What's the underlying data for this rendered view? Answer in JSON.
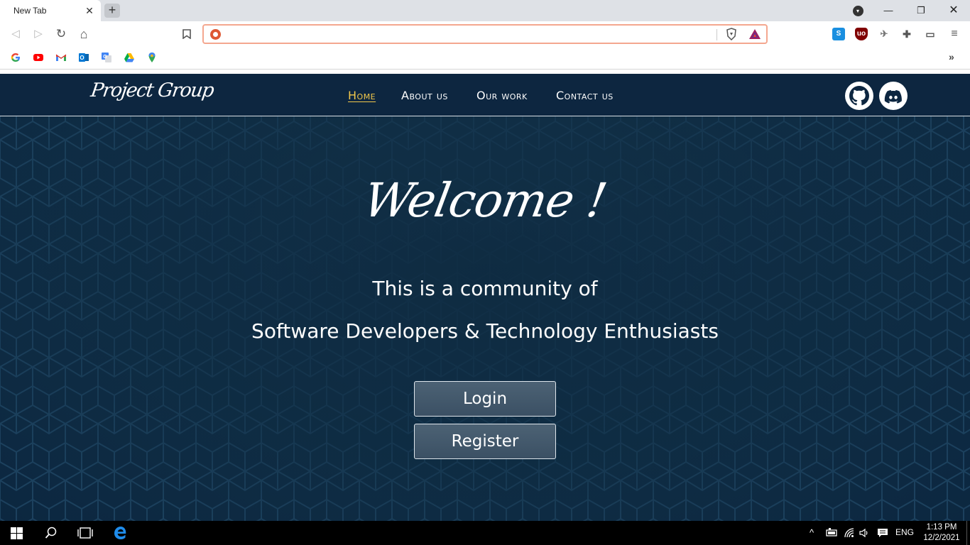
{
  "browser": {
    "tab_title": "New Tab",
    "tab_close": "✕",
    "new_tab": "+",
    "tab_search_icon": "▾",
    "window": {
      "minimize": "—",
      "restore": "❐",
      "close": "✕"
    },
    "nav": {
      "back": "◁",
      "forward": "▷",
      "reload": "↻",
      "home": "⌂",
      "bookmark": "🔖"
    },
    "url": {
      "value": "",
      "placeholder": ""
    },
    "menu": "≡",
    "bookmarks_overflow": "»"
  },
  "site": {
    "logo": "Project Group",
    "nav": [
      {
        "label": "Home",
        "active": true
      },
      {
        "label": "About us",
        "active": false
      },
      {
        "label": "Our work",
        "active": false
      },
      {
        "label": "Contact us",
        "active": false
      }
    ],
    "social": [
      "github-icon",
      "discord-icon"
    ],
    "hero": {
      "title": "Welcome !",
      "line1": "This is a community of",
      "line2": "Software Developers & Technology Enthusiasts",
      "login": "Login",
      "register": "Register"
    },
    "colors": {
      "nav_bg": "#0d2640",
      "active_link": "#f2c84b",
      "hero_bg": "#102f47",
      "button_bg": "#4c6274"
    }
  },
  "taskbar": {
    "language": "ENG",
    "time": "1:13 PM",
    "date": "12/2/2021",
    "tray_chevron": "^"
  }
}
